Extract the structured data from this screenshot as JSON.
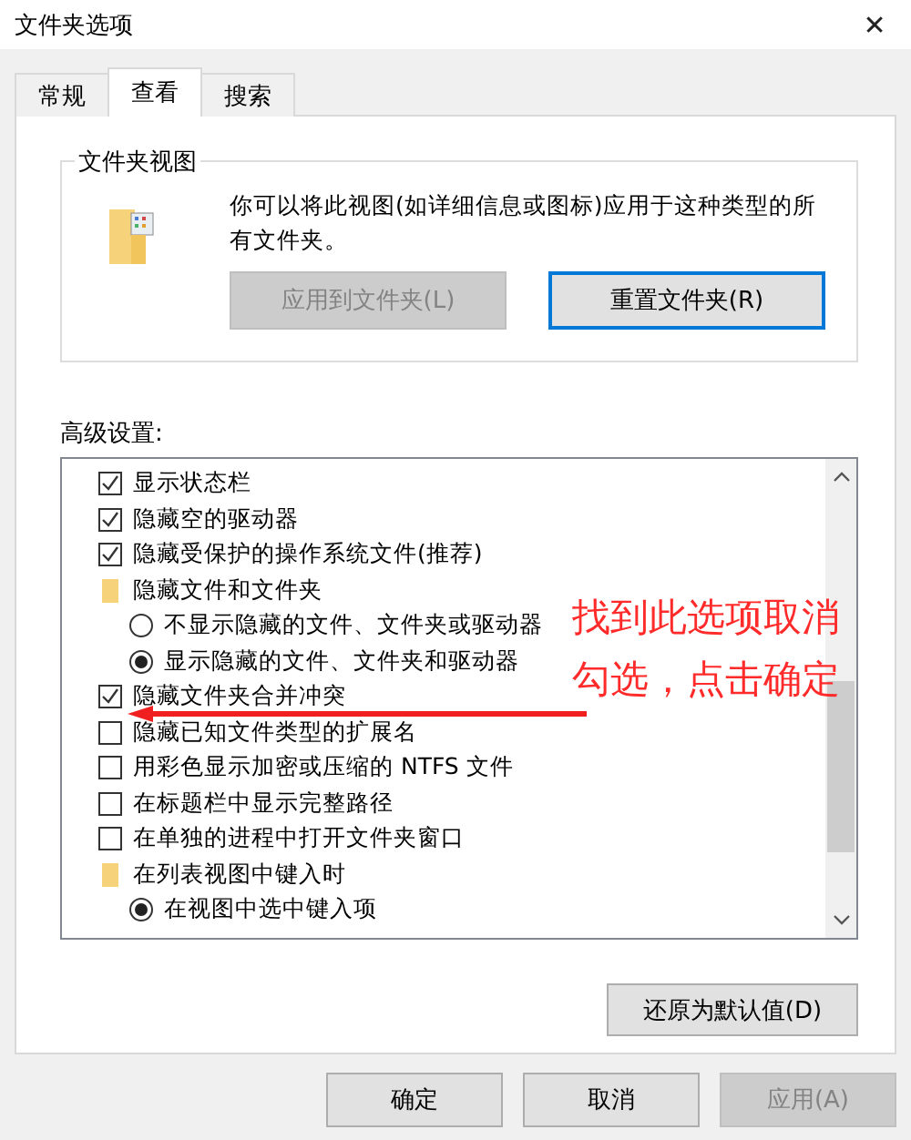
{
  "window": {
    "title": "文件夹选项",
    "close": "✕"
  },
  "tabs": [
    {
      "label": "常规",
      "selected": false
    },
    {
      "label": "查看",
      "selected": true
    },
    {
      "label": "搜索",
      "selected": false
    }
  ],
  "folder_views": {
    "title": "文件夹视图",
    "description": "你可以将此视图(如详细信息或图标)应用于这种类型的所有文件夹。",
    "buttons": [
      {
        "label": "应用到文件夹(L)",
        "disabled": true,
        "focused": false
      },
      {
        "label": "重置文件夹(R)",
        "disabled": false,
        "focused": true
      }
    ]
  },
  "advanced": {
    "label": "高级设置:",
    "items": [
      {
        "kind": "checkbox",
        "label": "显示状态栏",
        "checked": true
      },
      {
        "kind": "checkbox",
        "label": "隐藏空的驱动器",
        "checked": true
      },
      {
        "kind": "checkbox",
        "label": "隐藏受保护的操作系统文件(推荐)",
        "checked": true
      },
      {
        "kind": "folder",
        "label": "隐藏文件和文件夹",
        "children": [
          {
            "kind": "radio",
            "label": "不显示隐藏的文件、文件夹或驱动器",
            "selected": false
          },
          {
            "kind": "radio",
            "label": "显示隐藏的文件、文件夹和驱动器",
            "selected": true
          }
        ]
      },
      {
        "kind": "checkbox",
        "label": "隐藏文件夹合并冲突",
        "checked": true
      },
      {
        "kind": "checkbox",
        "label": "隐藏已知文件类型的扩展名",
        "checked": false
      },
      {
        "kind": "checkbox",
        "label": "用彩色显示加密或压缩的 NTFS 文件",
        "checked": false
      },
      {
        "kind": "checkbox",
        "label": "在标题栏中显示完整路径",
        "checked": false
      },
      {
        "kind": "checkbox",
        "label": "在单独的进程中打开文件夹窗口",
        "checked": false
      },
      {
        "kind": "folder",
        "label": "在列表视图中键入时",
        "children": [
          {
            "kind": "radio",
            "label": "在视图中选中键入项",
            "selected": true
          }
        ]
      }
    ],
    "restore_button": "还原为默认值(D)"
  },
  "annotation": {
    "lines": [
      "找到此选项取消",
      "勾选，点击确定"
    ]
  },
  "buttons": [
    {
      "label": "确定",
      "disabled": false
    },
    {
      "label": "取消",
      "disabled": false
    },
    {
      "label": "应用(A)",
      "disabled": true
    }
  ]
}
